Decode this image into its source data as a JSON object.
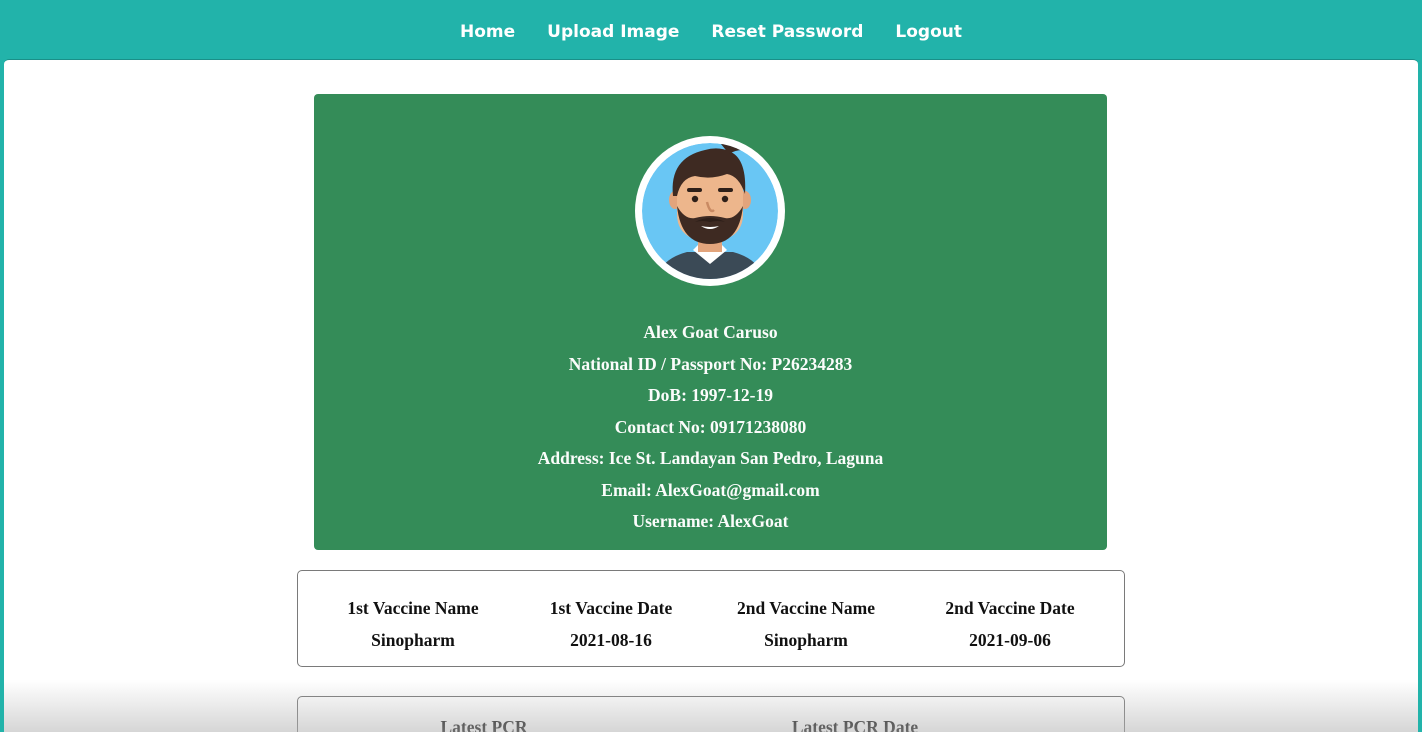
{
  "nav": {
    "items": [
      {
        "label": "Home"
      },
      {
        "label": "Upload Image"
      },
      {
        "label": "Reset Password"
      },
      {
        "label": "Logout"
      }
    ]
  },
  "profile": {
    "avatar_icon": "bearded-man-avatar-icon",
    "name": "Alex Goat Caruso",
    "national_id": "National ID / Passport No: P26234283",
    "dob": "DoB: 1997-12-19",
    "contact": "Contact No: 09171238080",
    "address": "Address: Ice St. Landayan San Pedro, Laguna",
    "email": "Email: AlexGoat@gmail.com",
    "username": "Username: AlexGoat"
  },
  "vaccine": {
    "columns": [
      {
        "header": "1st Vaccine Name",
        "value": "Sinopharm"
      },
      {
        "header": "1st Vaccine Date",
        "value": "2021-08-16"
      },
      {
        "header": "2nd Vaccine Name",
        "value": "Sinopharm"
      },
      {
        "header": "2nd Vaccine Date",
        "value": "2021-09-06"
      }
    ]
  },
  "pcr": {
    "columns": [
      {
        "header": "Latest PCR"
      },
      {
        "header": "Latest PCR Date"
      }
    ]
  },
  "colors": {
    "nav_bg": "#22b3aa",
    "card_bg": "#348c58"
  }
}
